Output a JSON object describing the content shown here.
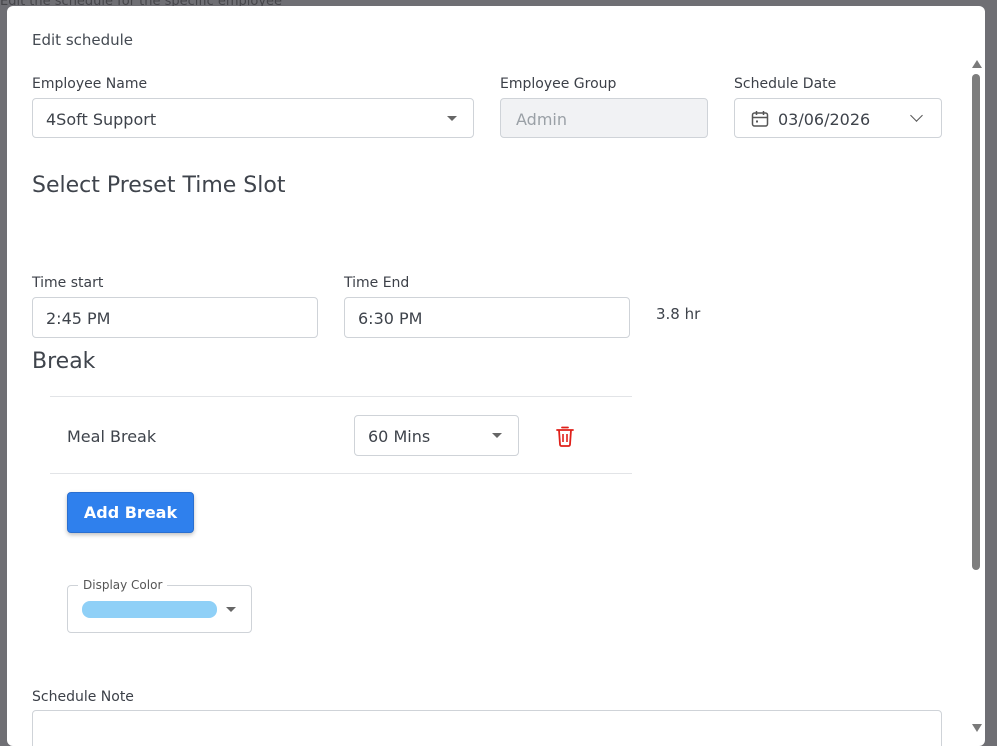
{
  "backdrop": {
    "text": "Edit the schedule for the specific employee"
  },
  "dialog": {
    "title": "Edit schedule",
    "employee_name": {
      "label": "Employee Name",
      "value": "4Soft Support"
    },
    "employee_group": {
      "label": "Employee Group",
      "value": "Admin"
    },
    "schedule_date": {
      "label": "Schedule Date",
      "value": "03/06/2026"
    },
    "preset_heading": "Select Preset Time Slot",
    "time_start": {
      "label": "Time start",
      "value": "2:45 PM"
    },
    "time_end": {
      "label": "Time End",
      "value": "6:30 PM"
    },
    "duration": "3.8 hr",
    "break_heading": "Break",
    "breaks": [
      {
        "name": "Meal Break",
        "duration": "60 Mins"
      }
    ],
    "add_break_label": "Add Break",
    "display_color": {
      "label": "Display Color",
      "color": "#8fd0f7"
    },
    "schedule_note": {
      "label": "Schedule Note",
      "value": ""
    }
  },
  "colors": {
    "primary": "#2f80ed",
    "danger": "#e0201a",
    "backdrop": "#6f6f74"
  }
}
